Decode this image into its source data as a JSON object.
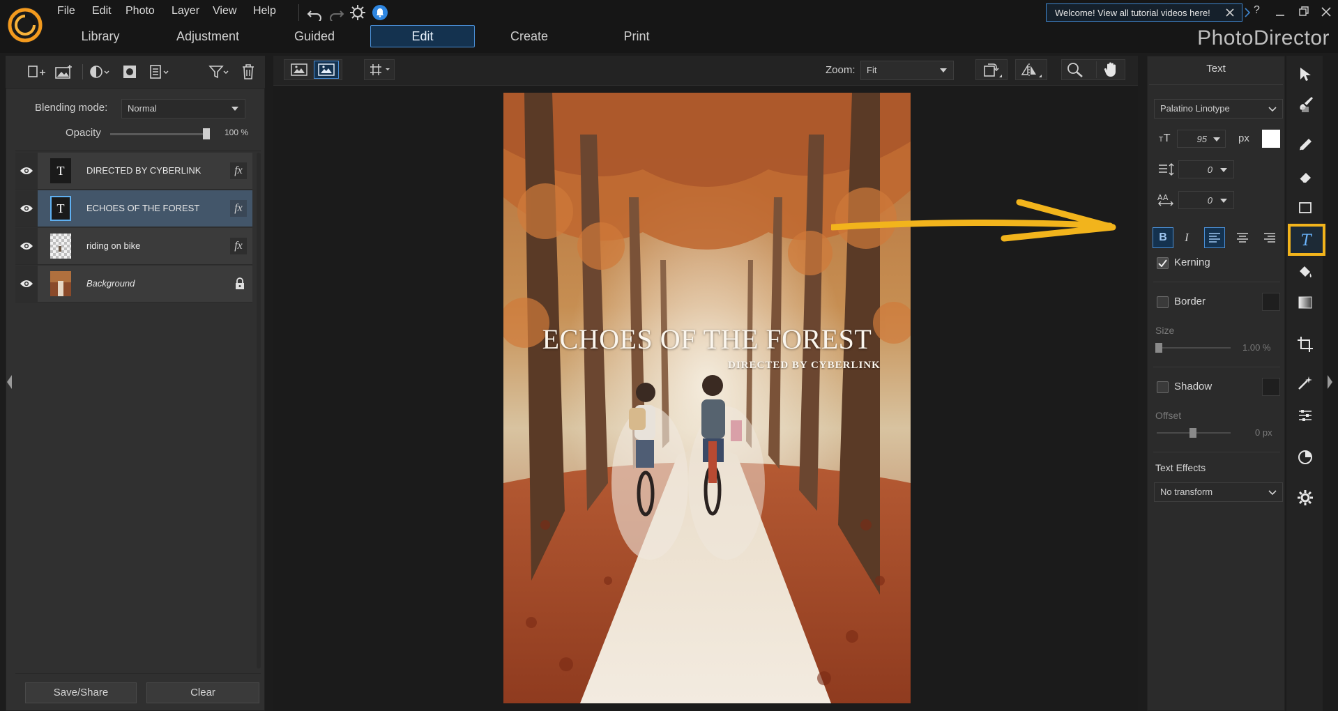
{
  "menu": [
    "File",
    "Edit",
    "Photo",
    "Layer",
    "View",
    "Help"
  ],
  "mode_tabs": [
    "Library",
    "Adjustment",
    "Guided",
    "Edit",
    "Create",
    "Print"
  ],
  "active_tab": "Edit",
  "welcome_banner": "Welcome! View all tutorial videos here!",
  "brand": "PhotoDirector",
  "help_glyph": "?",
  "layers_panel": {
    "blending_label": "Blending mode:",
    "blending_value": "Normal",
    "opacity_label": "Opacity",
    "opacity_value": "100 %",
    "opacity_fraction": 1.0,
    "layers": [
      {
        "name": "DIRECTED BY CYBERLINK",
        "thumb": "T",
        "fx": "fx",
        "type": "text"
      },
      {
        "name": "ECHOES OF THE FOREST",
        "thumb": "T",
        "fx": "fx",
        "type": "text",
        "selected": true
      },
      {
        "name": "riding on bike",
        "thumb": "",
        "fx": "fx",
        "type": "image"
      },
      {
        "name": "Background",
        "thumb": "",
        "fx": "",
        "type": "background",
        "locked": true
      }
    ],
    "save_share": "Save/Share",
    "clear": "Clear"
  },
  "canvas_bar": {
    "zoom_label": "Zoom:",
    "zoom_value": "Fit"
  },
  "poster": {
    "title": "ECHOES OF THE FOREST",
    "subtitle": "DIRECTED BY CYBERLINK"
  },
  "text_panel": {
    "title": "Text",
    "font": "Palatino Linotype",
    "size_value": "95",
    "size_unit": "px",
    "line_spacing": "0",
    "char_spacing": "0",
    "bold": "B",
    "italic": "I",
    "kerning_label": "Kerning",
    "kerning_checked": true,
    "border_label": "Border",
    "border_checked": false,
    "size_label": "Size",
    "size_pct": "1.00 %",
    "shadow_label": "Shadow",
    "shadow_checked": false,
    "offset_label": "Offset",
    "offset_value": "0 px",
    "effects_label": "Text Effects",
    "effects_value": "No transform"
  },
  "colors": {
    "accent_blue": "#4a8fd6",
    "highlight_yellow": "#f2b41c",
    "text_color": "#ffffff"
  },
  "tools": [
    "select-icon",
    "brush-icon",
    "pencil-icon",
    "eraser-icon",
    "rectangle-icon",
    "text-icon",
    "fill-icon",
    "gradient-icon",
    "crop-icon",
    "magic-icon",
    "adjust-icon",
    "color-wheel-icon",
    "settings-icon"
  ]
}
